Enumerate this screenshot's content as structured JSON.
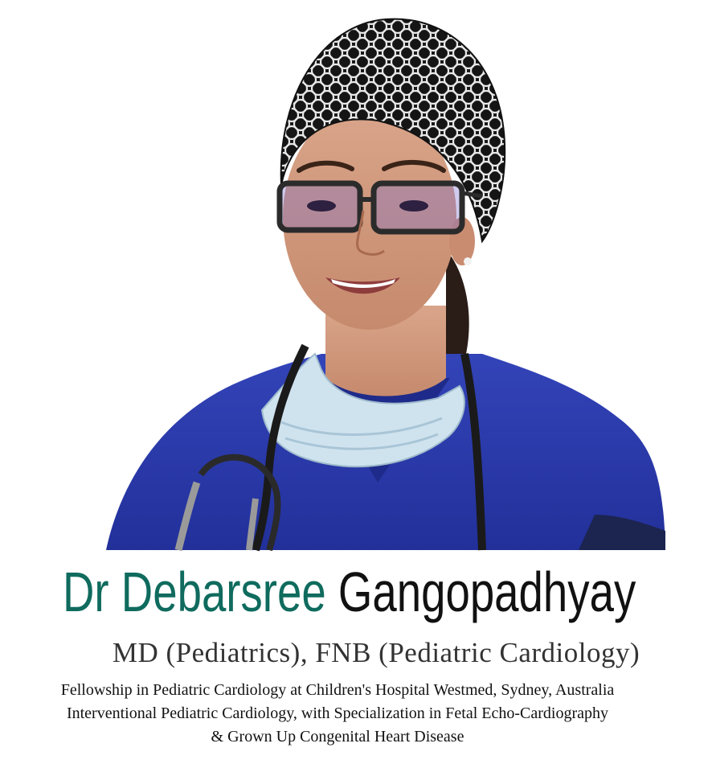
{
  "profile": {
    "name_first": "Dr Debarsree",
    "name_last": "Gangopadhyay",
    "degrees": "MD (Pediatrics), FNB (Pediatric Cardiology)",
    "lines": [
      "Fellowship in Pediatric Cardiology at Children's Hospital Westmed, Sydney, Australia",
      "Interventional Pediatric Cardiology, with Specialization in Fetal Echo-Cardiography",
      "& Grown Up Congenital Heart Disease"
    ]
  },
  "colors": {
    "accent": "#0f6b5e",
    "scrubs": "#2a3aa6",
    "cap": "#111111"
  }
}
